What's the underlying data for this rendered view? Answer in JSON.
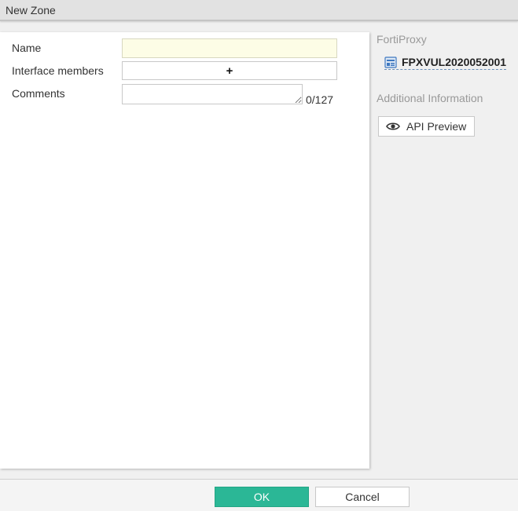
{
  "dialog": {
    "title": "New Zone"
  },
  "form": {
    "name_label": "Name",
    "name_value": "",
    "members_label": "Interface members",
    "members_add_glyph": "+",
    "comments_label": "Comments",
    "comments_value": "",
    "comments_counter": "0/127"
  },
  "sidebar": {
    "product_heading": "FortiProxy",
    "device_name": "FPXVUL2020052001",
    "device_icon": "device-icon",
    "additional_heading": "Additional Information",
    "api_preview_label": "API Preview",
    "api_preview_icon": "eye-icon"
  },
  "footer": {
    "ok_label": "OK",
    "cancel_label": "Cancel"
  },
  "colors": {
    "ok_button": "#2bb796",
    "name_field_bg": "#fdfde6",
    "muted_heading": "#999999"
  }
}
